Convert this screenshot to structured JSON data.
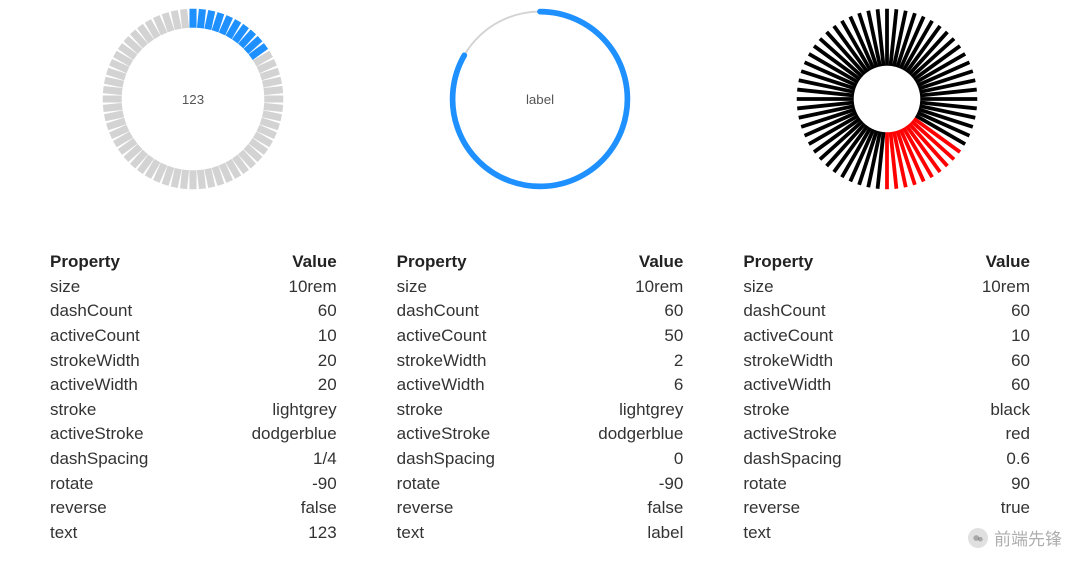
{
  "chart_data": [
    {
      "type": "radial-dashes",
      "dashCount": 60,
      "activeCount": 10,
      "strokeWidth": 20,
      "activeWidth": 20,
      "stroke": "lightgrey",
      "activeStroke": "dodgerblue",
      "dashSpacing": 0.25,
      "rotate": -90,
      "reverse": false,
      "centerText": "123",
      "size": "10rem"
    },
    {
      "type": "radial-dashes",
      "dashCount": 60,
      "activeCount": 50,
      "strokeWidth": 2,
      "activeWidth": 6,
      "stroke": "lightgrey",
      "activeStroke": "dodgerblue",
      "dashSpacing": 0,
      "rotate": -90,
      "reverse": false,
      "centerText": "label",
      "size": "10rem"
    },
    {
      "type": "radial-dashes",
      "dashCount": 60,
      "activeCount": 10,
      "strokeWidth": 60,
      "activeWidth": 60,
      "stroke": "black",
      "activeStroke": "red",
      "dashSpacing": 0.6,
      "rotate": 90,
      "reverse": true,
      "centerText": "",
      "size": "10rem"
    }
  ],
  "table": {
    "headers": {
      "property": "Property",
      "value": "Value"
    },
    "propNames": [
      "size",
      "dashCount",
      "activeCount",
      "strokeWidth",
      "activeWidth",
      "stroke",
      "activeStroke",
      "dashSpacing",
      "rotate",
      "reverse",
      "text"
    ],
    "cols": [
      {
        "size": "10rem",
        "dashCount": "60",
        "activeCount": "10",
        "strokeWidth": "20",
        "activeWidth": "20",
        "stroke": "lightgrey",
        "activeStroke": "dodgerblue",
        "dashSpacing": "1/4",
        "rotate": "-90",
        "reverse": "false",
        "text": "123"
      },
      {
        "size": "10rem",
        "dashCount": "60",
        "activeCount": "50",
        "strokeWidth": "2",
        "activeWidth": "6",
        "stroke": "lightgrey",
        "activeStroke": "dodgerblue",
        "dashSpacing": "0",
        "rotate": "-90",
        "reverse": "false",
        "text": "label"
      },
      {
        "size": "10rem",
        "dashCount": "60",
        "activeCount": "10",
        "strokeWidth": "60",
        "activeWidth": "60",
        "stroke": "black",
        "activeStroke": "red",
        "dashSpacing": "0.6",
        "rotate": "90",
        "reverse": "true",
        "text": ""
      }
    ]
  },
  "watermark": "前端先锋"
}
